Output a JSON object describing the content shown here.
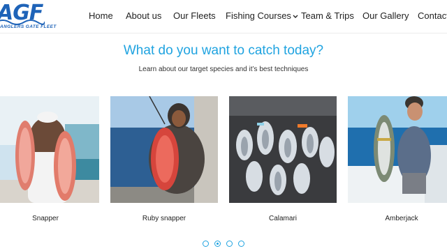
{
  "logo": {
    "mark": "AGF",
    "subtitle": "ANGLERS GATE FLEET"
  },
  "nav": [
    {
      "label": "Home"
    },
    {
      "label": "About us"
    },
    {
      "label": "Our Fleets"
    },
    {
      "label": "Fishing Courses"
    },
    {
      "label": "Team & Trips"
    },
    {
      "label": "Our Gallery"
    },
    {
      "label": "Contact"
    }
  ],
  "section": {
    "title": "What do you want to catch today?",
    "subtitle": "Learn about our target species and it’s best techniques"
  },
  "cards": [
    {
      "caption": "Snapper"
    },
    {
      "caption": "Ruby snapper"
    },
    {
      "caption": "Calamari"
    },
    {
      "caption": "Amberjack"
    }
  ],
  "carousel": {
    "page_count": 4,
    "active_page": 2
  },
  "colors": {
    "accent": "#1fa3e0",
    "logo": "#1e63b8"
  }
}
